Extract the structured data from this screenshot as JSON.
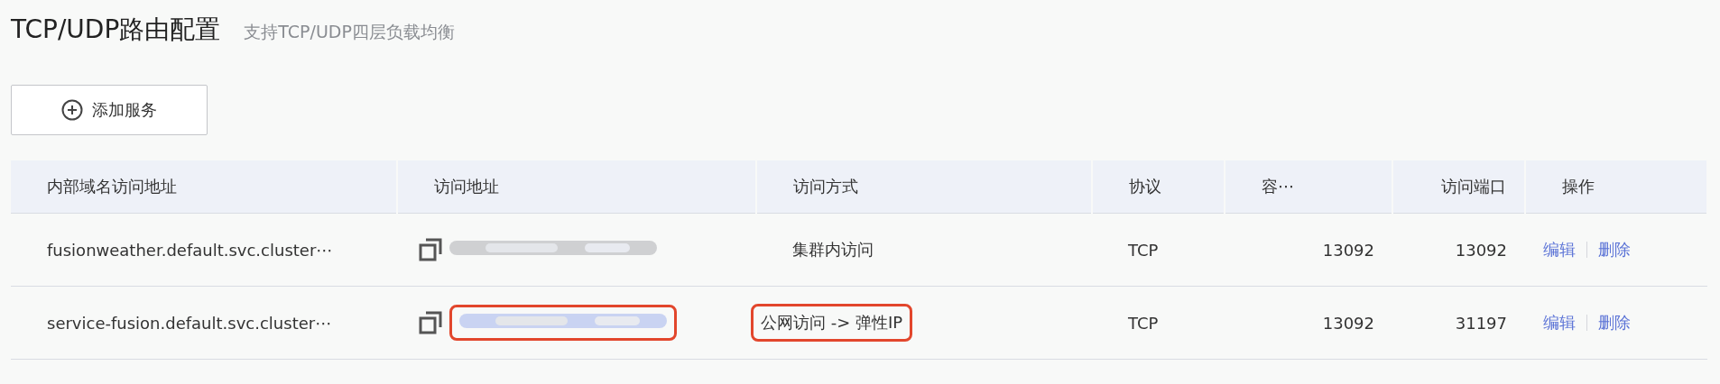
{
  "header": {
    "title": "TCP/UDP路由配置",
    "subtitle": "支持TCP/UDP四层负载均衡"
  },
  "add_button": {
    "label": "添加服务"
  },
  "table": {
    "columns": [
      "内部域名访问地址",
      "访问地址",
      "访问方式",
      "协议",
      "容⋯",
      "访问端口",
      "操作"
    ],
    "rows": [
      {
        "internal_domain": "fusionweather.default.svc.cluster⋯",
        "address": {
          "kind": "plain",
          "highlighted": false
        },
        "access_method": "集群内访问",
        "method_highlighted": false,
        "protocol": "TCP",
        "container_port": "13092",
        "access_port": "13092",
        "actions": [
          "编辑",
          "删除"
        ]
      },
      {
        "internal_domain": "service-fusion.default.svc.cluster⋯",
        "address": {
          "kind": "link",
          "highlighted": true
        },
        "access_method": "公网访问 -> 弹性IP",
        "method_highlighted": true,
        "protocol": "TCP",
        "container_port": "13092",
        "access_port": "31197",
        "actions": [
          "编辑",
          "删除"
        ]
      }
    ]
  }
}
